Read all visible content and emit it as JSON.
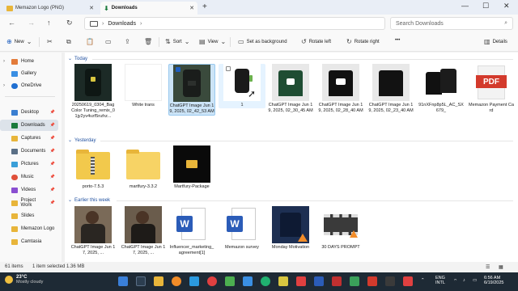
{
  "tabs": {
    "inactive": {
      "label": "Memazon Logo (PNG)"
    },
    "active": {
      "label": "Downloads"
    },
    "new_tab": "+",
    "close": "✕"
  },
  "window": {
    "minimize": "—",
    "maximize": "☐",
    "close": "✕"
  },
  "address": {
    "breadcrumb_sep": "›",
    "current": "Downloads",
    "search_placeholder": "Search Downloads"
  },
  "toolbar": {
    "new_label": "New",
    "sort_label": "Sort",
    "view_label": "View",
    "set_background_label": "Set as background",
    "rotate_left_label": "Rotate left",
    "rotate_right_label": "Rotate right",
    "more_label": "•••",
    "details_label": "Details"
  },
  "sidebar": {
    "items": [
      {
        "label": "Home",
        "color": "#e37b3a"
      },
      {
        "label": "Gallery",
        "color": "#3a8fe3"
      },
      {
        "label": "OneDrive",
        "color": "#1f6fd1"
      },
      {
        "label": "Desktop",
        "color": "#3a7fd1"
      },
      {
        "label": "Downloads",
        "color": "#1a7a3b"
      },
      {
        "label": "Captures",
        "color": "#e8b53a"
      },
      {
        "label": "Documents",
        "color": "#5a6f86"
      },
      {
        "label": "Pictures",
        "color": "#3a9fd8"
      },
      {
        "label": "Music",
        "color": "#e0503a"
      },
      {
        "label": "Videos",
        "color": "#8a4fd1"
      },
      {
        "label": "Project Work",
        "color": "#e8b53a"
      },
      {
        "label": "Slides",
        "color": "#e8b53a"
      },
      {
        "label": "Memazon Logo",
        "color": "#e8b53a"
      },
      {
        "label": "Camtasia",
        "color": "#e8b53a"
      }
    ]
  },
  "groups": {
    "today": "Today",
    "yesterday": "Yesterday",
    "earlier": "Earlier this week"
  },
  "files": {
    "today": [
      {
        "name": "20250619_0304_Bag Color Tuning_remix_01jy2yv4vzf5nzhz...",
        "kind": "bag"
      },
      {
        "name": "White trans",
        "kind": "white"
      },
      {
        "name": "ChatGPT Image Jun 19, 2025, 02_42_53 AM",
        "kind": "bag-sel"
      },
      {
        "name": "1",
        "kind": "bag-small"
      },
      {
        "name": "ChatGPT Image Jun 19, 2025, 02_30_45 AM",
        "kind": "tshirt-green"
      },
      {
        "name": "ChatGPT Image Jun 19, 2025, 02_28_40 AM",
        "kind": "tshirt-black"
      },
      {
        "name": "ChatGPT Image Jun 19, 2025, 02_23_40 AM",
        "kind": "tshirt-plain"
      },
      {
        "name": "91nXFnp8p5L_AC_SX679_",
        "kind": "tshirt-pair"
      },
      {
        "name": "Memazon Payment Card",
        "kind": "pdf"
      }
    ],
    "yesterday": [
      {
        "name": "porto-7.5.3",
        "kind": "zip"
      },
      {
        "name": "martfury-3.3.2",
        "kind": "folder"
      },
      {
        "name": "Martfury-Package",
        "kind": "folder-dark"
      }
    ],
    "earlier": [
      {
        "name": "ChatGPT Image Jun 17, 2025, ...",
        "kind": "photo"
      },
      {
        "name": "ChatGPT Image Jun 17, 2025, ...",
        "kind": "photo"
      },
      {
        "name": "Influencer_marketing_agreement[1]",
        "kind": "word"
      },
      {
        "name": "Memazon survey",
        "kind": "word"
      },
      {
        "name": "Monday Motivation",
        "kind": "video-blue"
      },
      {
        "name": "30 DAYS PROMPT",
        "kind": "film"
      }
    ]
  },
  "pdf_label": "PDF",
  "word_label": "W",
  "status": {
    "count": "61 items",
    "selected": "1 item selected  1.36 MB"
  },
  "taskbar": {
    "temp": "23°C",
    "weather": "Mostly cloudy",
    "lang1": "ENG",
    "lang2": "INTL",
    "time": "6:56 AM",
    "date": "6/19/2025"
  }
}
